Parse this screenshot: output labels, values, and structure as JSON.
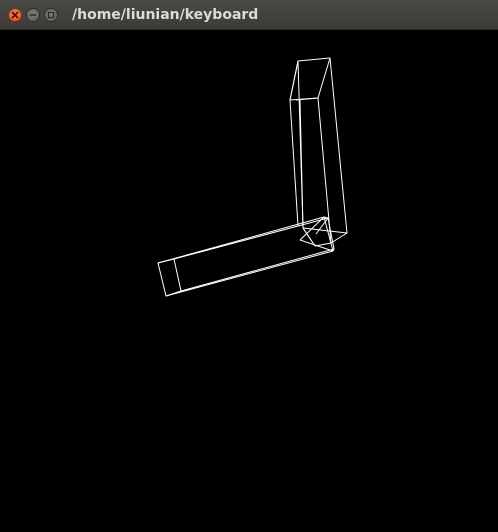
{
  "window": {
    "title": "/home/liunian/keyboard"
  },
  "titlebar": {
    "close_icon": "close-icon",
    "minimize_icon": "minimize-icon",
    "maximize_icon": "maximize-icon"
  },
  "colors": {
    "canvas_background": "#000000",
    "wireframe": "#ffffff",
    "titlebar": "#3c3b37",
    "title_text": "#dfdbd2",
    "close_button": "#df4a16"
  }
}
